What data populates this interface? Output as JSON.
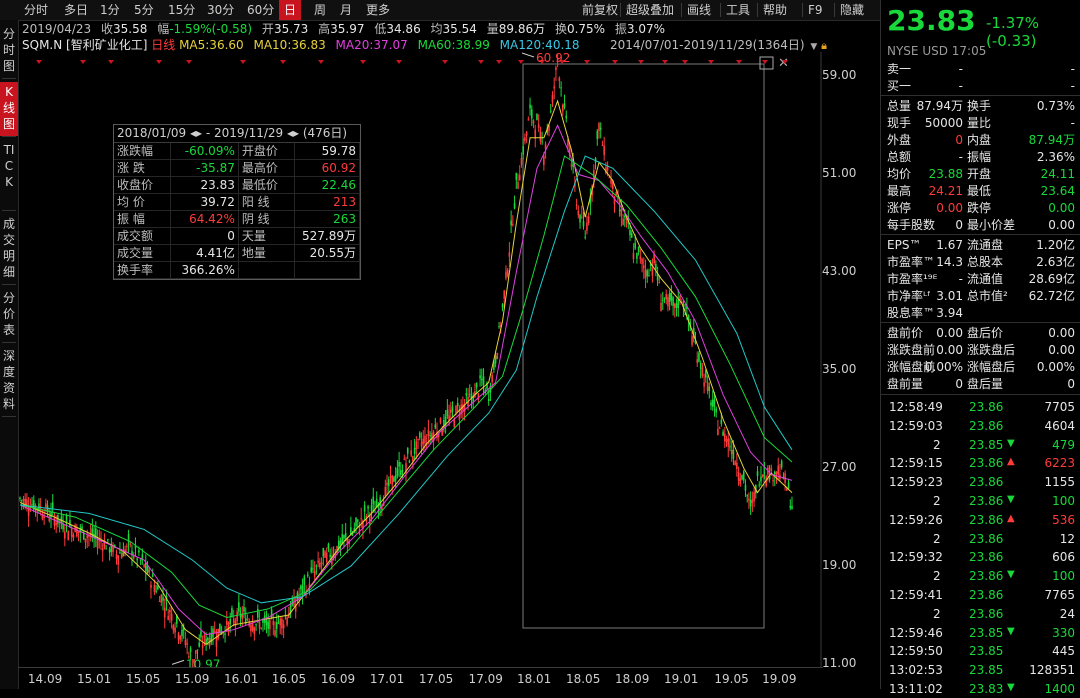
{
  "topbar": {
    "periods": [
      "分时",
      "多日",
      "1分",
      "5分",
      "15分",
      "30分",
      "60分",
      "日",
      "周",
      "月",
      "更多"
    ],
    "active_period": "日",
    "actions": [
      "前复权",
      "超级叠加",
      "画线",
      "工具",
      "帮助",
      "F9",
      "隐藏"
    ]
  },
  "lefttabs": [
    "分时图",
    "K线图",
    "TICK",
    "成交明细",
    "分价表",
    "深度资料"
  ],
  "info_line": {
    "date": "2019/04/23",
    "close_label": "收",
    "close": "35.58",
    "change_label": "幅",
    "change": "-1.59%(-0.58)",
    "open_label": "开",
    "open": "35.73",
    "high_label": "高",
    "high": "35.97",
    "low_label": "低",
    "low": "34.86",
    "avg_label": "均",
    "avg": "35.54",
    "volume_label": "量",
    "volume": "89.86万",
    "turnover_label": "换",
    "turnover": "0.75%",
    "amplitude_label": "振",
    "amplitude": "3.07%"
  },
  "ma_line": {
    "symbol": "SQM.N [智利矿业化工]",
    "period": "日线",
    "ma5": "MA5:36.60",
    "ma10": "MA10:36.83",
    "ma20": "MA20:37.07",
    "ma60": "MA60:38.99",
    "ma120": "MA120:40.18",
    "range": "2014/07/01-2019/11/29(1364日)"
  },
  "statbox": {
    "header": "2018/01/09 ◂▸ - 2019/11/29 ◂▸  (476日)",
    "rows": [
      [
        "涨跌幅",
        "-60.09%",
        "开盘价",
        "59.78"
      ],
      [
        "涨  跌",
        "-35.87",
        "最高价",
        "60.92"
      ],
      [
        "收盘价",
        "23.83",
        "最低价",
        "22.46"
      ],
      [
        "均  价",
        "39.72",
        "阳  线",
        "213"
      ],
      [
        "振  幅",
        "64.42%",
        "阴  线",
        "263"
      ],
      [
        "成交额",
        "0",
        "天量",
        "527.89万"
      ],
      [
        "成交量",
        "4.41亿",
        "地量",
        "20.55万"
      ],
      [
        "换手率",
        "366.26%",
        "",
        ""
      ]
    ]
  },
  "chart_data": {
    "type": "line",
    "title": "",
    "x": [
      "14.09",
      "15.01",
      "15.05",
      "15.09",
      "16.01",
      "16.05",
      "16.09",
      "17.01",
      "17.05",
      "17.09",
      "18.01",
      "18.05",
      "18.09",
      "19.01",
      "19.05",
      "19.09"
    ],
    "yticks": [
      "59.00",
      "51.00",
      "43.00",
      "35.00",
      "27.00",
      "19.00",
      "11.00"
    ],
    "ylim": [
      11,
      61
    ],
    "annotations": [
      {
        "text": "60.92",
        "x": "2018-01",
        "y": 60.92
      },
      {
        "text": "10.97",
        "x": "2015-07",
        "y": 10.97
      }
    ],
    "series": [
      {
        "name": "",
        "color": "#d9d9d9",
        "points": [
          [
            0,
            24.5
          ],
          [
            4,
            24
          ],
          [
            8,
            23.5
          ],
          [
            12,
            22.5
          ],
          [
            16,
            22
          ],
          [
            20,
            21.5
          ],
          [
            24,
            21
          ],
          [
            28,
            20
          ],
          [
            32,
            20.5
          ],
          [
            36,
            19
          ],
          [
            40,
            17
          ],
          [
            44,
            15
          ],
          [
            48,
            13
          ],
          [
            50,
            11.2
          ],
          [
            52,
            12.5
          ],
          [
            56,
            13.5
          ],
          [
            60,
            14
          ],
          [
            64,
            15
          ],
          [
            68,
            14.5
          ],
          [
            72,
            14
          ],
          [
            76,
            14.5
          ],
          [
            80,
            16
          ],
          [
            84,
            18
          ],
          [
            88,
            19.5
          ],
          [
            92,
            20.5
          ],
          [
            96,
            21.5
          ],
          [
            100,
            23
          ],
          [
            104,
            24
          ],
          [
            108,
            26
          ],
          [
            112,
            27.5
          ],
          [
            116,
            29
          ],
          [
            120,
            30
          ],
          [
            124,
            31
          ],
          [
            128,
            32
          ],
          [
            132,
            33
          ],
          [
            134,
            34
          ],
          [
            136,
            33
          ],
          [
            138,
            36
          ],
          [
            140,
            40
          ],
          [
            142,
            45
          ],
          [
            144,
            50
          ],
          [
            146,
            53
          ],
          [
            148,
            56
          ],
          [
            150,
            55
          ],
          [
            152,
            53
          ],
          [
            154,
            56
          ],
          [
            156,
            60.5
          ],
          [
            158,
            56
          ],
          [
            160,
            52
          ],
          [
            162,
            48
          ],
          [
            164,
            46
          ],
          [
            166,
            50
          ],
          [
            168,
            55
          ],
          [
            170,
            52
          ],
          [
            172,
            50
          ],
          [
            174,
            48
          ],
          [
            176,
            47
          ],
          [
            178,
            45
          ],
          [
            180,
            44
          ],
          [
            182,
            43
          ],
          [
            184,
            44
          ],
          [
            186,
            41
          ],
          [
            188,
            40.5
          ],
          [
            190,
            40
          ],
          [
            192,
            41
          ],
          [
            194,
            39
          ],
          [
            196,
            37
          ],
          [
            198,
            35
          ],
          [
            200,
            33
          ],
          [
            202,
            31
          ],
          [
            204,
            30
          ],
          [
            206,
            29
          ],
          [
            208,
            27.5
          ],
          [
            210,
            26
          ],
          [
            212,
            23.5
          ],
          [
            214,
            26
          ],
          [
            216,
            27
          ],
          [
            218,
            26.5
          ],
          [
            220,
            27
          ],
          [
            222,
            26
          ],
          [
            224,
            23.8
          ]
        ]
      },
      {
        "name": "",
        "color": "#e8d23c",
        "points": [
          [
            0,
            24.2
          ],
          [
            10,
            23
          ],
          [
            20,
            21.7
          ],
          [
            30,
            20.2
          ],
          [
            40,
            17.5
          ],
          [
            48,
            13.8
          ],
          [
            54,
            12.6
          ],
          [
            62,
            14.2
          ],
          [
            70,
            14.6
          ],
          [
            78,
            15
          ],
          [
            86,
            18
          ],
          [
            94,
            21
          ],
          [
            102,
            23.3
          ],
          [
            110,
            26
          ],
          [
            118,
            29
          ],
          [
            126,
            31.3
          ],
          [
            132,
            33
          ],
          [
            136,
            34
          ],
          [
            140,
            39
          ],
          [
            144,
            47
          ],
          [
            148,
            54
          ],
          [
            152,
            54
          ],
          [
            156,
            57
          ],
          [
            160,
            53
          ],
          [
            164,
            47.5
          ],
          [
            168,
            52
          ],
          [
            172,
            50.5
          ],
          [
            176,
            47.5
          ],
          [
            180,
            45
          ],
          [
            186,
            42.5
          ],
          [
            192,
            40.5
          ],
          [
            198,
            36
          ],
          [
            204,
            31
          ],
          [
            210,
            27
          ],
          [
            214,
            25
          ],
          [
            218,
            26.6
          ],
          [
            224,
            25
          ]
        ]
      },
      {
        "name": "",
        "color": "#e040e0",
        "points": [
          [
            0,
            24
          ],
          [
            12,
            22.5
          ],
          [
            24,
            21
          ],
          [
            36,
            19.5
          ],
          [
            46,
            15.5
          ],
          [
            54,
            13.4
          ],
          [
            62,
            13.8
          ],
          [
            72,
            14.8
          ],
          [
            82,
            16.5
          ],
          [
            92,
            20
          ],
          [
            102,
            22.8
          ],
          [
            112,
            26.5
          ],
          [
            122,
            30
          ],
          [
            132,
            32.5
          ],
          [
            138,
            34
          ],
          [
            144,
            43
          ],
          [
            150,
            51.5
          ],
          [
            156,
            55
          ],
          [
            162,
            51
          ],
          [
            168,
            50.5
          ],
          [
            174,
            48.5
          ],
          [
            180,
            46
          ],
          [
            188,
            43
          ],
          [
            196,
            39
          ],
          [
            204,
            33
          ],
          [
            212,
            28.3
          ],
          [
            218,
            26.5
          ],
          [
            224,
            26
          ]
        ]
      },
      {
        "name": "",
        "color": "#19d93a",
        "points": [
          [
            0,
            24
          ],
          [
            16,
            23
          ],
          [
            32,
            21
          ],
          [
            44,
            18.5
          ],
          [
            52,
            15.8
          ],
          [
            60,
            14.8
          ],
          [
            72,
            15.5
          ],
          [
            84,
            17
          ],
          [
            96,
            20.5
          ],
          [
            108,
            24.5
          ],
          [
            120,
            28.5
          ],
          [
            132,
            32
          ],
          [
            140,
            34.5
          ],
          [
            146,
            40
          ],
          [
            152,
            46
          ],
          [
            158,
            52.5
          ],
          [
            166,
            51
          ],
          [
            176,
            48.5
          ],
          [
            186,
            45
          ],
          [
            196,
            41
          ],
          [
            206,
            35.5
          ],
          [
            216,
            29.5
          ],
          [
            224,
            27.5
          ]
        ]
      },
      {
        "name": "",
        "color": "#21c8c8",
        "points": [
          [
            0,
            24
          ],
          [
            20,
            23.3
          ],
          [
            36,
            22
          ],
          [
            50,
            19.5
          ],
          [
            60,
            17.2
          ],
          [
            70,
            16
          ],
          [
            82,
            16.5
          ],
          [
            96,
            19
          ],
          [
            110,
            23.3
          ],
          [
            124,
            28
          ],
          [
            136,
            31.5
          ],
          [
            144,
            35
          ],
          [
            150,
            41
          ],
          [
            158,
            48
          ],
          [
            164,
            52.5
          ],
          [
            172,
            51.5
          ],
          [
            184,
            48
          ],
          [
            196,
            44
          ],
          [
            208,
            38
          ],
          [
            216,
            32
          ],
          [
            224,
            28.5
          ]
        ]
      }
    ]
  },
  "right": {
    "price": "23.83",
    "change": "-1.37% (-0.33)",
    "sub": "NYSE  USD  17:05",
    "rows": [
      {
        "l": "卖一",
        "v": "-",
        "l2": "",
        "v2": "-"
      },
      {
        "l": "买一",
        "v": "-",
        "l2": "",
        "v2": "-"
      },
      {
        "l": "总量",
        "v": "87.94万",
        "l2": "换手",
        "v2": "0.73%"
      },
      {
        "l": "现手",
        "v": "50000",
        "l2": "量比",
        "v2": "-"
      },
      {
        "l": "外盘",
        "v": "0",
        "l2": "内盘",
        "v2": "87.94万"
      },
      {
        "l": "总额",
        "v": "-",
        "l2": "振幅",
        "v2": "2.36%"
      },
      {
        "l": "均价",
        "v": "23.88",
        "l2": "开盘",
        "v2": "24.11"
      },
      {
        "l": "最高",
        "v": "24.21",
        "l2": "最低",
        "v2": "23.64"
      },
      {
        "l": "涨停",
        "v": "0.00",
        "l2": "跌停",
        "v2": "0.00"
      },
      {
        "l": "每手股数",
        "v": "0",
        "l2": "最小价差",
        "v2": "0.00"
      },
      {
        "l": "EPS™",
        "v": "1.67",
        "l2": "流通盘",
        "v2": "1.20亿"
      },
      {
        "l": "市盈率™",
        "v": "14.3",
        "l2": "总股本",
        "v2": "2.63亿"
      },
      {
        "l": "市盈率¹⁹ᴱ",
        "v": "-",
        "l2": "流通值",
        "v2": "28.69亿"
      },
      {
        "l": "市净率ᴸᶠ",
        "v": "3.01",
        "l2": "总市值²",
        "v2": "62.72亿"
      },
      {
        "l": "股息率™",
        "v": "3.94",
        "l2": "",
        "v2": ""
      },
      {
        "l": "盘前价",
        "v": "0.00",
        "l2": "盘后价",
        "v2": "0.00"
      },
      {
        "l": "涨跌盘前",
        "v": "0.00",
        "l2": "涨跌盘后",
        "v2": "0.00"
      },
      {
        "l": "涨幅盘前",
        "v": "0.00%",
        "l2": "涨幅盘后",
        "v2": "0.00%"
      },
      {
        "l": "盘前量",
        "v": "0",
        "l2": "盘后量",
        "v2": "0"
      }
    ],
    "ticks": [
      {
        "t": "12:58:49",
        "p": "23.86",
        "d": "",
        "v": "7705"
      },
      {
        "t": "12:59:03",
        "p": "23.86",
        "d": "",
        "v": "4604"
      },
      {
        "t": "2",
        "p": "23.85",
        "d": "down",
        "v": "479"
      },
      {
        "t": "12:59:15",
        "p": "23.86",
        "d": "up",
        "v": "6223"
      },
      {
        "t": "12:59:23",
        "p": "23.86",
        "d": "",
        "v": "1155"
      },
      {
        "t": "2",
        "p": "23.86",
        "d": "down",
        "v": "100"
      },
      {
        "t": "12:59:26",
        "p": "23.86",
        "d": "up",
        "v": "536"
      },
      {
        "t": "2",
        "p": "23.86",
        "d": "",
        "v": "12"
      },
      {
        "t": "12:59:32",
        "p": "23.86",
        "d": "",
        "v": "606"
      },
      {
        "t": "2",
        "p": "23.86",
        "d": "down",
        "v": "100"
      },
      {
        "t": "12:59:41",
        "p": "23.86",
        "d": "",
        "v": "7765"
      },
      {
        "t": "2",
        "p": "23.86",
        "d": "",
        "v": "24"
      },
      {
        "t": "12:59:46",
        "p": "23.85",
        "d": "down",
        "v": "330"
      },
      {
        "t": "12:59:50",
        "p": "23.85",
        "d": "",
        "v": "445"
      },
      {
        "t": "13:02:53",
        "p": "23.85",
        "d": "",
        "v": "128351"
      },
      {
        "t": "13:11:02",
        "p": "23.83",
        "d": "down",
        "v": "1400"
      }
    ]
  }
}
